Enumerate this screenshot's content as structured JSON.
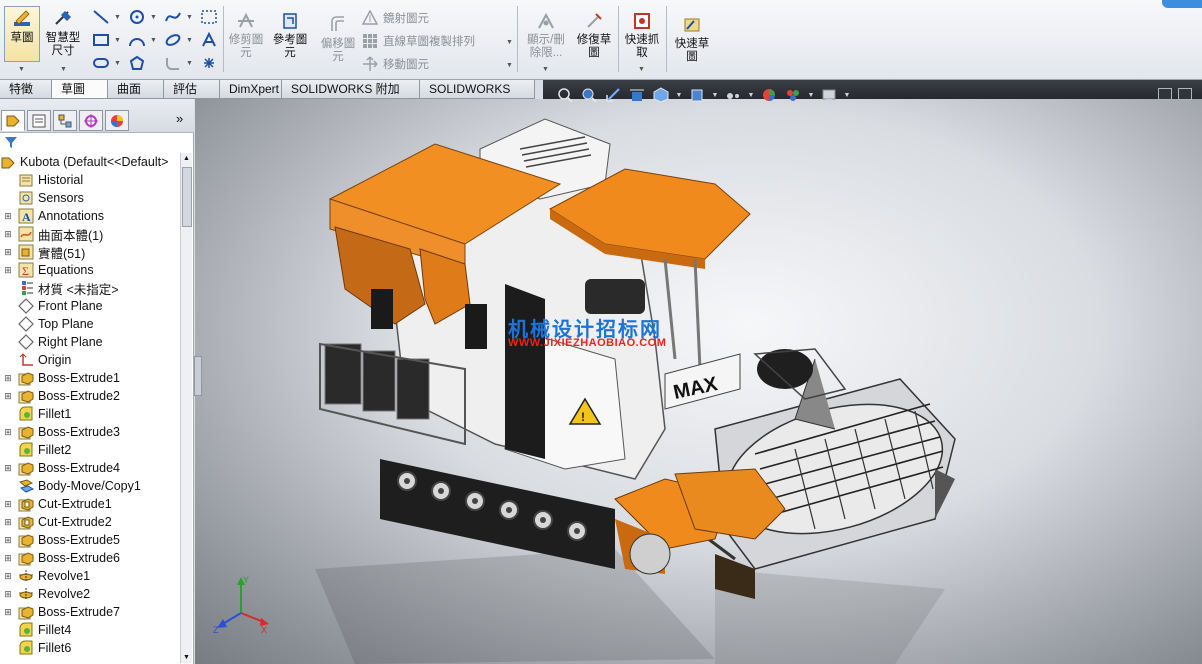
{
  "ribbon": {
    "sketch": "草圖",
    "smart_dimension": "智慧型尺寸",
    "trim_entities": "修剪圖元",
    "convert_entities": "參考圖元",
    "offset_entities": "偏移圖元",
    "mirror_entities": "鏡射圖元",
    "linear_pattern": "直線草圖複製排列",
    "move_entities": "移動圖元",
    "display_delete_relations": "顯示/刪除限...",
    "repair_sketch": "修復草圖",
    "quick_snaps": "快速抓取",
    "rapid_sketch": "快速草圖"
  },
  "tabs": [
    "特徵",
    "草圖",
    "曲面",
    "評估",
    "DimXpert",
    "SOLIDWORKS 附加程式",
    "SOLIDWORKS MBD"
  ],
  "active_tab": "草圖",
  "tree": {
    "root": "Kubota  (Default<<Default>",
    "items": [
      {
        "label": "Historial",
        "icon": "history-icon",
        "exp": ""
      },
      {
        "label": "Sensors",
        "icon": "sensor-icon",
        "exp": ""
      },
      {
        "label": "Annotations",
        "icon": "annotation-icon",
        "exp": "+"
      },
      {
        "label": "曲面本體(1)",
        "icon": "surface-bodies-icon",
        "exp": "+"
      },
      {
        "label": "實體(51)",
        "icon": "solid-bodies-icon",
        "exp": "+"
      },
      {
        "label": "Equations",
        "icon": "equation-icon",
        "exp": "+"
      },
      {
        "label": "材質 <未指定>",
        "icon": "material-icon",
        "exp": ""
      },
      {
        "label": "Front Plane",
        "icon": "plane-icon",
        "exp": ""
      },
      {
        "label": "Top Plane",
        "icon": "plane-icon",
        "exp": ""
      },
      {
        "label": "Right Plane",
        "icon": "plane-icon",
        "exp": ""
      },
      {
        "label": "Origin",
        "icon": "origin-icon",
        "exp": ""
      },
      {
        "label": "Boss-Extrude1",
        "icon": "extrude-icon",
        "exp": "+"
      },
      {
        "label": "Boss-Extrude2",
        "icon": "extrude-icon",
        "exp": "+"
      },
      {
        "label": "Fillet1",
        "icon": "fillet-icon",
        "exp": ""
      },
      {
        "label": "Boss-Extrude3",
        "icon": "extrude-icon",
        "exp": "+"
      },
      {
        "label": "Fillet2",
        "icon": "fillet-icon",
        "exp": ""
      },
      {
        "label": "Boss-Extrude4",
        "icon": "extrude-icon",
        "exp": "+"
      },
      {
        "label": "Body-Move/Copy1",
        "icon": "move-copy-icon",
        "exp": ""
      },
      {
        "label": "Cut-Extrude1",
        "icon": "cut-extrude-icon",
        "exp": "+"
      },
      {
        "label": "Cut-Extrude2",
        "icon": "cut-extrude-icon",
        "exp": "+"
      },
      {
        "label": "Boss-Extrude5",
        "icon": "extrude-icon",
        "exp": "+"
      },
      {
        "label": "Boss-Extrude6",
        "icon": "extrude-icon",
        "exp": "+"
      },
      {
        "label": "Revolve1",
        "icon": "revolve-icon",
        "exp": "+"
      },
      {
        "label": "Revolve2",
        "icon": "revolve-icon",
        "exp": "+"
      },
      {
        "label": "Boss-Extrude7",
        "icon": "extrude-icon",
        "exp": "+"
      },
      {
        "label": "Fillet4",
        "icon": "fillet-icon",
        "exp": ""
      },
      {
        "label": "Fillet6",
        "icon": "fillet-icon",
        "exp": ""
      }
    ]
  },
  "viewport": {
    "watermark_cn": "机械设计招标网",
    "watermark_url": "WWW.JIXIEZHAOBIAO.COM",
    "decal_text": "MAX"
  },
  "colors": {
    "accent_orange": "#f08a1c",
    "model_white": "#f2f2f2",
    "watermark_blue": "#1e73d6",
    "watermark_red": "#e8241e"
  }
}
